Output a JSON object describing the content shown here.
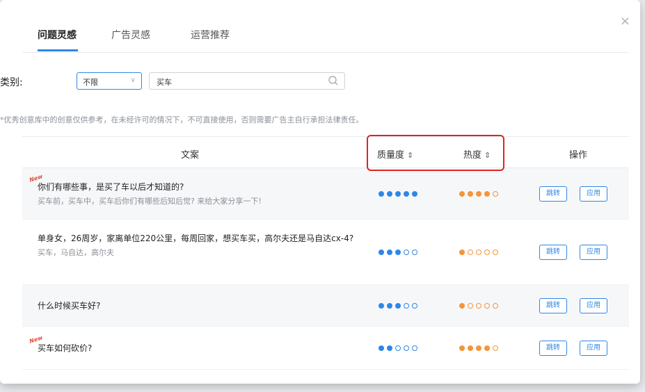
{
  "modal": {
    "close_glyph": "×"
  },
  "tabs": [
    {
      "label": "问题灵感",
      "active": true
    },
    {
      "label": "广告灵感",
      "active": false
    },
    {
      "label": "运营推荐",
      "active": false
    }
  ],
  "filter": {
    "label": "类别:",
    "select_value": "不限",
    "search_value": "买车"
  },
  "notice": "*优秀创意库中的创意仅供参考，在未经许可的情况下，不可直接使用，否则需要广告主自行承担法律责任。",
  "table": {
    "headers": {
      "copy": "文案",
      "quality": "质量度",
      "heat": "热度",
      "action": "操作",
      "sort_glyph": "⇕"
    },
    "rows": [
      {
        "is_new": true,
        "new_label": "New",
        "title": "你们有哪些事，是买了车以后才知道的?",
        "subtitle": "买车前，买车中，买车后你们有哪些后知后觉? 来给大家分享一下!",
        "quality": 5,
        "heat": 4
      },
      {
        "is_new": false,
        "title": "单身女，26周岁，家离单位220公里，每周回家，想买车买，高尔夫还是马自达cx-4?",
        "subtitle": "买车，马自达，高尔夫",
        "quality": 3,
        "heat": 1
      },
      {
        "is_new": false,
        "title": "什么时候买车好?",
        "subtitle": "",
        "quality": 3,
        "heat": 1
      },
      {
        "is_new": true,
        "new_label": "New",
        "title": "买车如何砍价?",
        "subtitle": "",
        "quality": 2,
        "heat": 4
      }
    ],
    "jump_label": "跳转",
    "apply_label": "应用",
    "max_rating": 5
  },
  "colors": {
    "accent": "#2e87e8",
    "quality_dot": "#2e87e8",
    "heat_dot": "#f5953a",
    "highlight": "#e02222"
  }
}
